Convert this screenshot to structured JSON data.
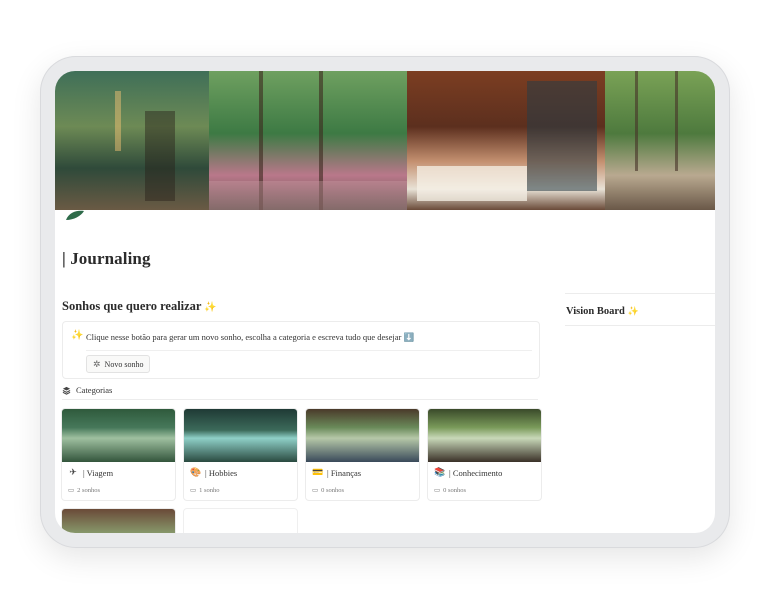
{
  "page": {
    "title": "| Journaling"
  },
  "dreams": {
    "heading": "Sonhos que quero realizar",
    "heading_emoji": "✨",
    "callout_icon": "✨",
    "callout_text": "Clique nesse botão para gerar um novo sonho, escolha a categoria e escreva tudo que desejar ⬇️",
    "new_button_icon": "✲",
    "new_button_label": "Novo sonho"
  },
  "categories": {
    "label": "Categorias",
    "icon": "layers-icon",
    "items": [
      {
        "icon": "✈",
        "icon_name": "airplane-icon",
        "name": "| Viagem",
        "count": "2 sonhos"
      },
      {
        "icon": "🎨",
        "icon_name": "palette-icon",
        "name": "| Hobbies",
        "count": "1 sonho"
      },
      {
        "icon": "💳",
        "icon_name": "card-icon",
        "name": "| Finanças",
        "count": "0 sonhos"
      },
      {
        "icon": "📚",
        "icon_name": "books-icon",
        "name": "| Conhecimento",
        "count": "0 sonhos"
      }
    ]
  },
  "vision_board": {
    "heading": "Vision Board",
    "heading_emoji": "✨"
  },
  "colors": {
    "accent_green": "#2e6b4a",
    "text": "#2b2b2b",
    "border": "#ececec"
  }
}
